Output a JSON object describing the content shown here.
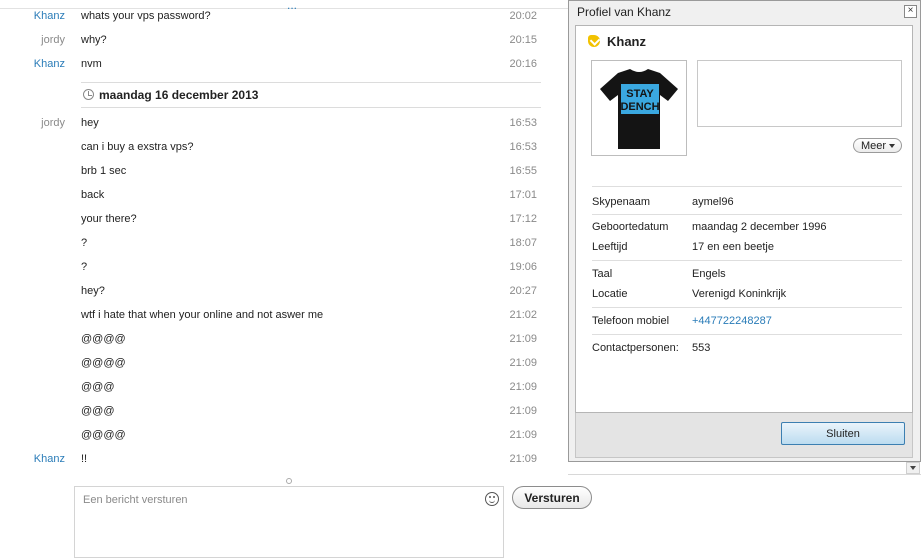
{
  "chat": {
    "top_indicator": "...",
    "messages_before": [
      {
        "sender": "Khanz",
        "sender_class": "khanz",
        "text": "whats your vps password?",
        "time": "20:02"
      },
      {
        "sender": "jordy",
        "sender_class": "jordy",
        "text": "why?",
        "time": "20:15"
      },
      {
        "sender": "Khanz",
        "sender_class": "khanz",
        "text": "nvm",
        "time": "20:16"
      }
    ],
    "date_separator": "maandag 16 december 2013",
    "messages_after": [
      {
        "sender": "jordy",
        "sender_class": "jordy",
        "text": "hey",
        "time": "16:53"
      },
      {
        "sender": "",
        "sender_class": "jordy",
        "text": "can i buy a exstra vps?",
        "time": "16:53"
      },
      {
        "sender": "",
        "sender_class": "jordy",
        "text": "brb 1 sec",
        "time": "16:55"
      },
      {
        "sender": "",
        "sender_class": "jordy",
        "text": "back",
        "time": "17:01"
      },
      {
        "sender": "",
        "sender_class": "jordy",
        "text": "your there?",
        "time": "17:12"
      },
      {
        "sender": "",
        "sender_class": "jordy",
        "text": "?",
        "time": "18:07"
      },
      {
        "sender": "",
        "sender_class": "jordy",
        "text": "?",
        "time": "19:06"
      },
      {
        "sender": "",
        "sender_class": "jordy",
        "text": "hey?",
        "time": "20:27"
      },
      {
        "sender": "",
        "sender_class": "jordy",
        "text": "wtf i hate that when your online and not aswer me",
        "time": "21:02"
      },
      {
        "sender": "",
        "sender_class": "jordy",
        "text": "@@@@",
        "time": "21:09"
      },
      {
        "sender": "",
        "sender_class": "jordy",
        "text": "@@@@",
        "time": "21:09"
      },
      {
        "sender": "",
        "sender_class": "jordy",
        "text": "@@@",
        "time": "21:09"
      },
      {
        "sender": "",
        "sender_class": "jordy",
        "text": "@@@",
        "time": "21:09"
      },
      {
        "sender": "",
        "sender_class": "jordy",
        "text": "@@@@",
        "time": "21:09"
      },
      {
        "sender": "Khanz",
        "sender_class": "khanz",
        "text": "!!",
        "time": "21:09"
      }
    ],
    "input_placeholder": "Een bericht versturen",
    "send_label": "Versturen"
  },
  "profile": {
    "window_title": "Profiel van Khanz",
    "close_glyph": "×",
    "name": "Khanz",
    "avatar_shirt_text_line1": "STAY",
    "avatar_shirt_text_line2": "DENCH",
    "meer_label": "Meer",
    "fields": {
      "skypename_label": "Skypenaam",
      "skypename_value": "aymel96",
      "birthdate_label": "Geboortedatum",
      "birthdate_value": "maandag 2 december 1996",
      "age_label": "Leeftijd",
      "age_value": "17 en een beetje",
      "language_label": "Taal",
      "language_value": "Engels",
      "location_label": "Locatie",
      "location_value": "Verenigd Koninkrijk",
      "phone_label": "Telefoon mobiel",
      "phone_value": "+447722248287",
      "contacts_label": "Contactpersonen:",
      "contacts_value": "553"
    },
    "close_button_label": "Sluiten"
  },
  "colors": {
    "sender_khanz": "#2a7cb8",
    "sender_other": "#8a8a8a",
    "link": "#2a7cb8",
    "status_yellow": "#f2c200",
    "shirt_print": "#3aa8e0"
  }
}
